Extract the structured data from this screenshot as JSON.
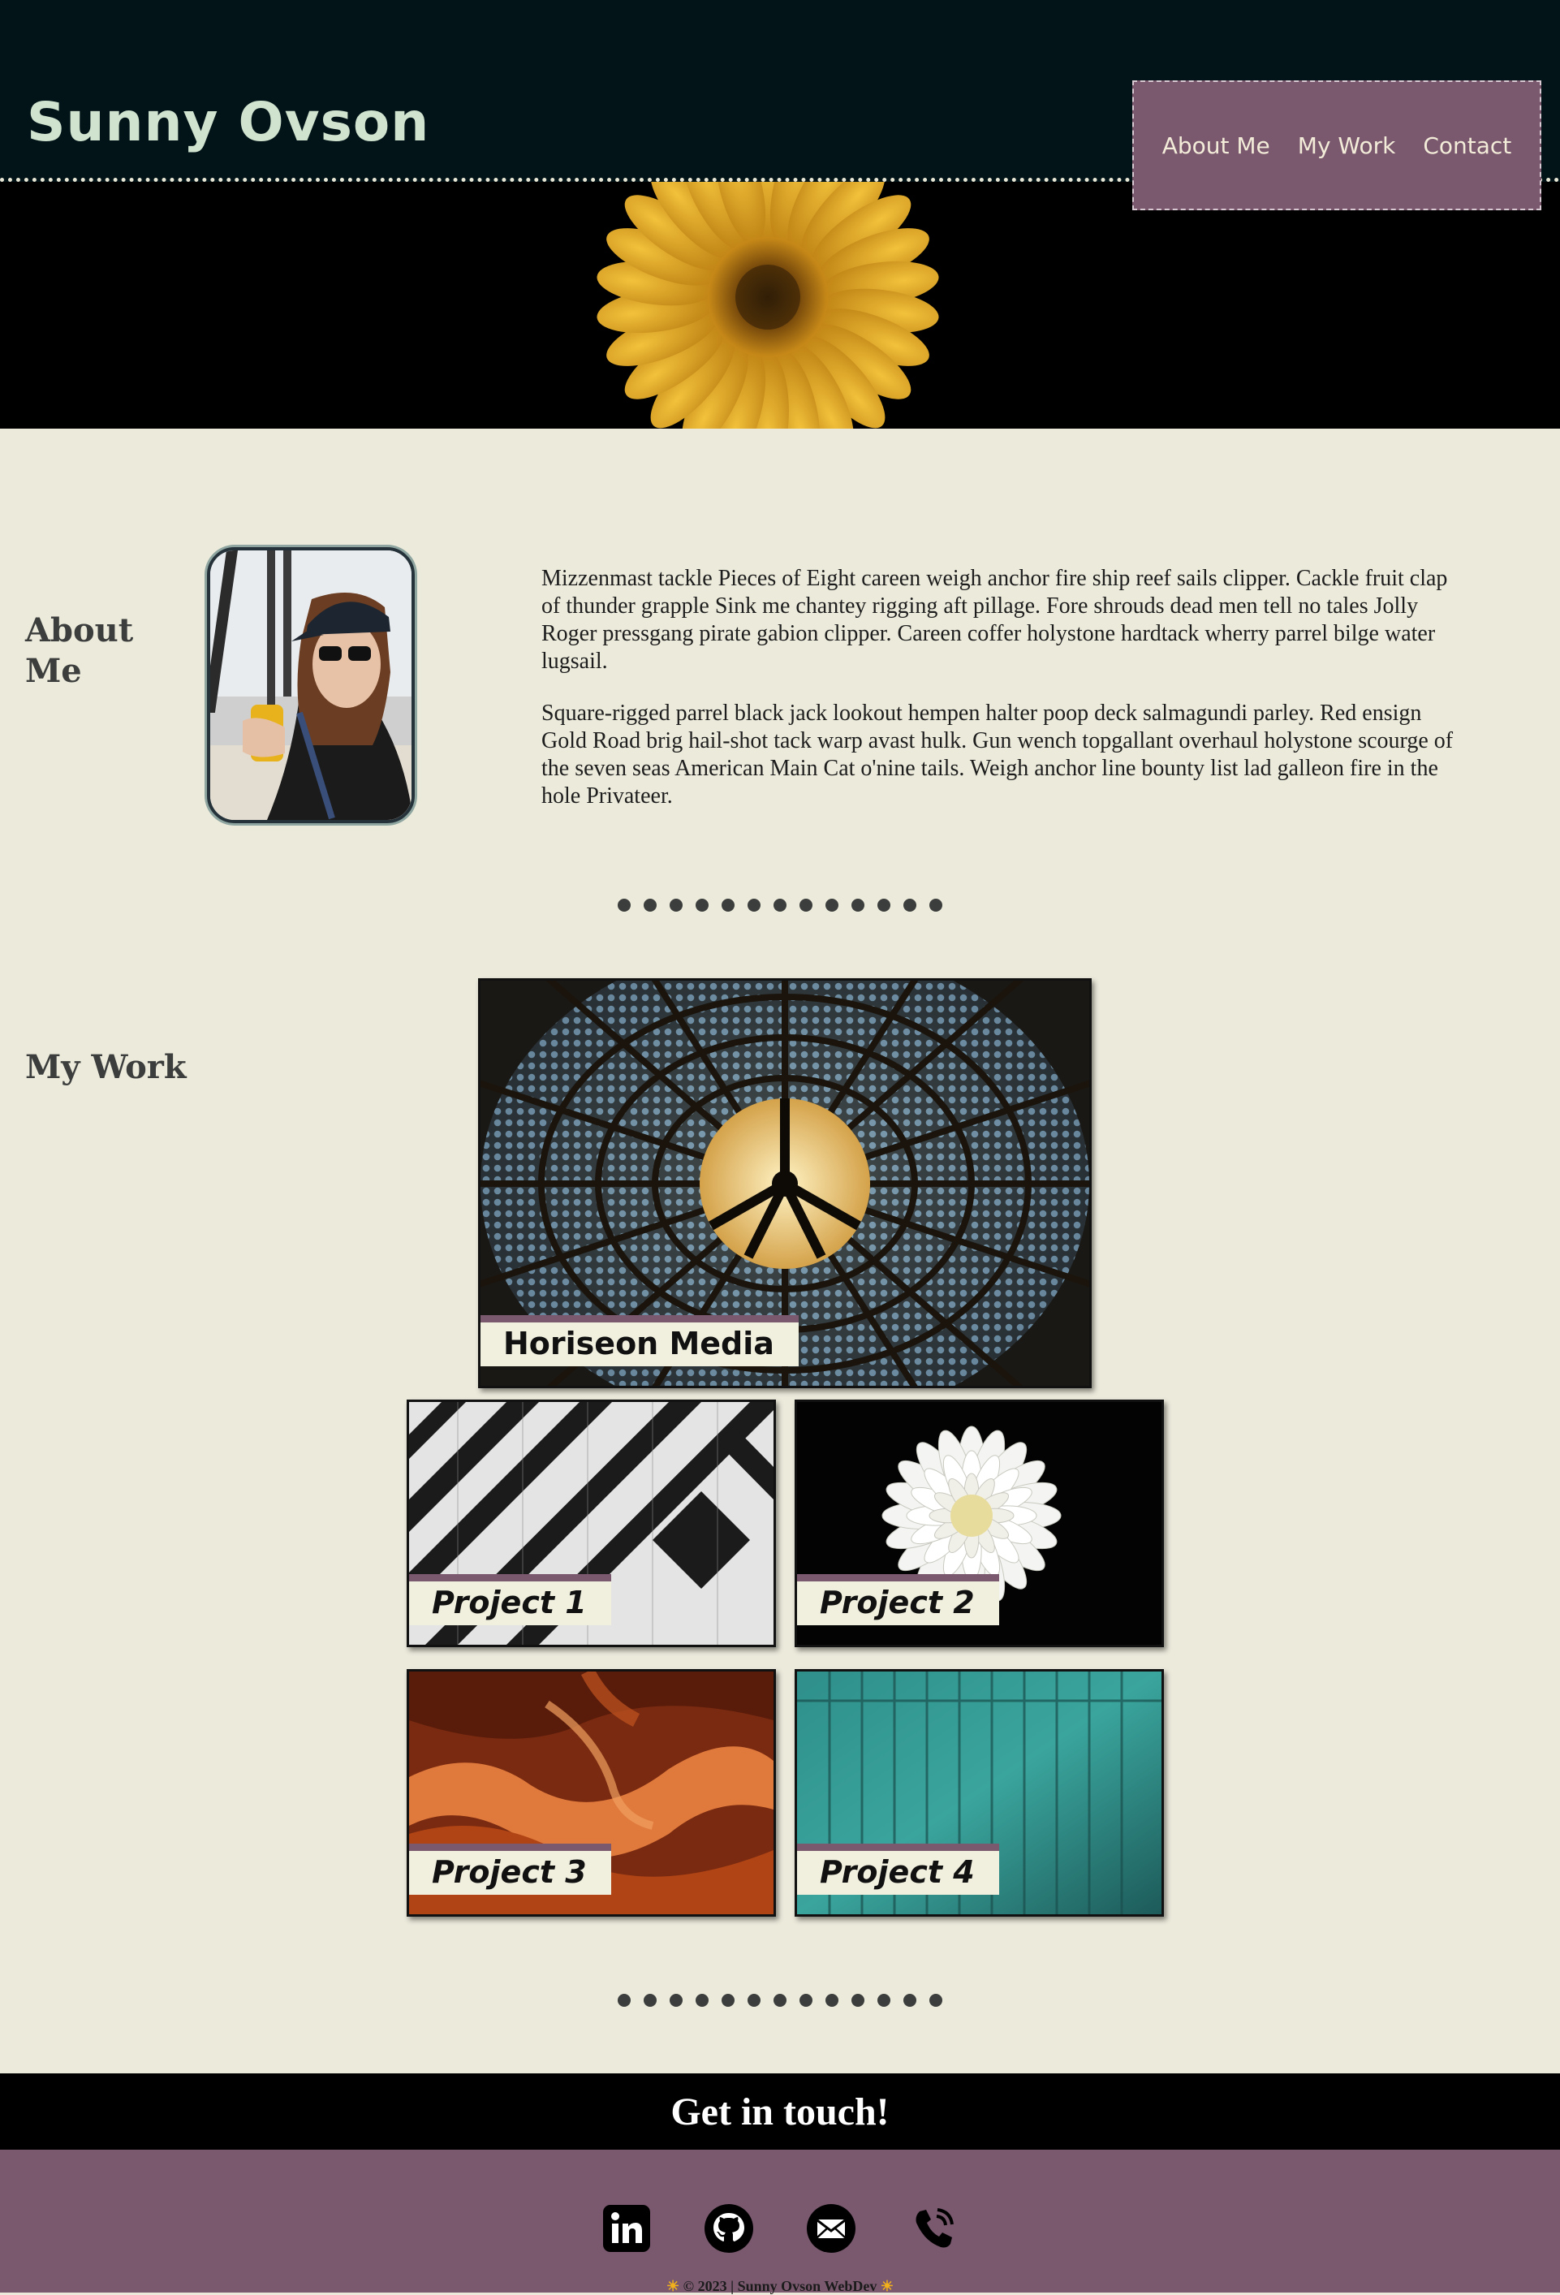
{
  "header": {
    "title": "Sunny Ovson",
    "nav": [
      "About Me",
      "My Work",
      "Contact"
    ]
  },
  "about": {
    "heading_line1": "About",
    "heading_line2": "Me",
    "paragraphs": [
      "Mizzenmast tackle Pieces of Eight careen weigh anchor fire ship reef sails clipper. Cackle fruit clap of thunder grapple Sink me chantey rigging aft pillage. Fore shrouds dead men tell no tales Jolly Roger pressgang pirate gabion clipper. Careen coffer holystone hardtack wherry parrel bilge water lugsail.",
      "Square-rigged parrel black jack lookout hempen halter poop deck salmagundi parley. Red ensign Gold Road brig hail-shot tack warp avast hulk. Gun wench topgallant overhaul holystone scourge of the seven seas American Main Cat o'nine tails. Weigh anchor line bounty list lad galleon fire in the hole Privateer."
    ]
  },
  "work": {
    "heading": "My Work",
    "featured": "Horiseon Media",
    "projects": [
      "Project 1",
      "Project 2",
      "Project 3",
      "Project 4"
    ]
  },
  "contact": {
    "heading": "Get in touch!",
    "icons": [
      "linkedin-icon",
      "github-icon",
      "email-icon",
      "phone-icon"
    ],
    "copyright": "© 2023 | Sunny Ovson WebDev"
  },
  "colors": {
    "header_bg": "#031418",
    "accent": "#7a596f",
    "page_bg": "#eceadb",
    "title": "#cfe3cf"
  }
}
